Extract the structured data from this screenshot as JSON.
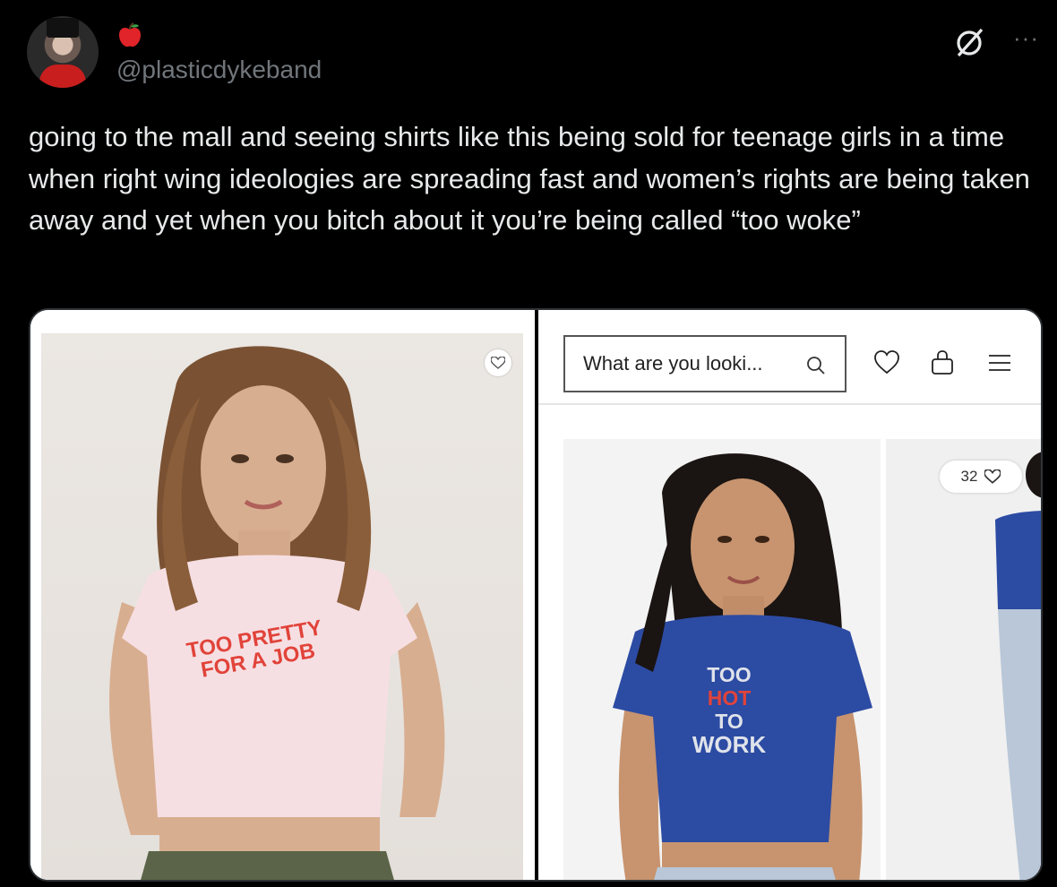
{
  "author": {
    "handle": "@plasticdykeband",
    "badge_icon": "red-apple-icon",
    "avatar_icon": "profile-avatar"
  },
  "header_icons": [
    "grok-icon",
    "more-icon"
  ],
  "more_label": "···",
  "tweet": {
    "text": "going to the mall and seeing shirts like this being sold for teenage girls in a time when right wing ideologies are spreading fast and women’s rights are being taken away and yet when you bitch about it you’re being called “too woke”"
  },
  "media": {
    "left_product": {
      "shirt_text_line1": "TOO PRETTY",
      "shirt_text_line2": "FOR A JOB",
      "shirt_color": "#f6dfe3",
      "text_color": "#e1433a"
    },
    "right_store": {
      "search_placeholder": "What are you looki...",
      "icons": [
        "search-icon",
        "heart-icon",
        "shopping-bag-icon",
        "menu-icon"
      ],
      "product": {
        "shirt_text": [
          "TOO",
          "HOT",
          "TO",
          "WORK"
        ],
        "shirt_color": "#2c4ba3",
        "hot_color": "#e1433a",
        "text_color": "#dfe3ea"
      },
      "adjacent_like_count": "32"
    }
  }
}
